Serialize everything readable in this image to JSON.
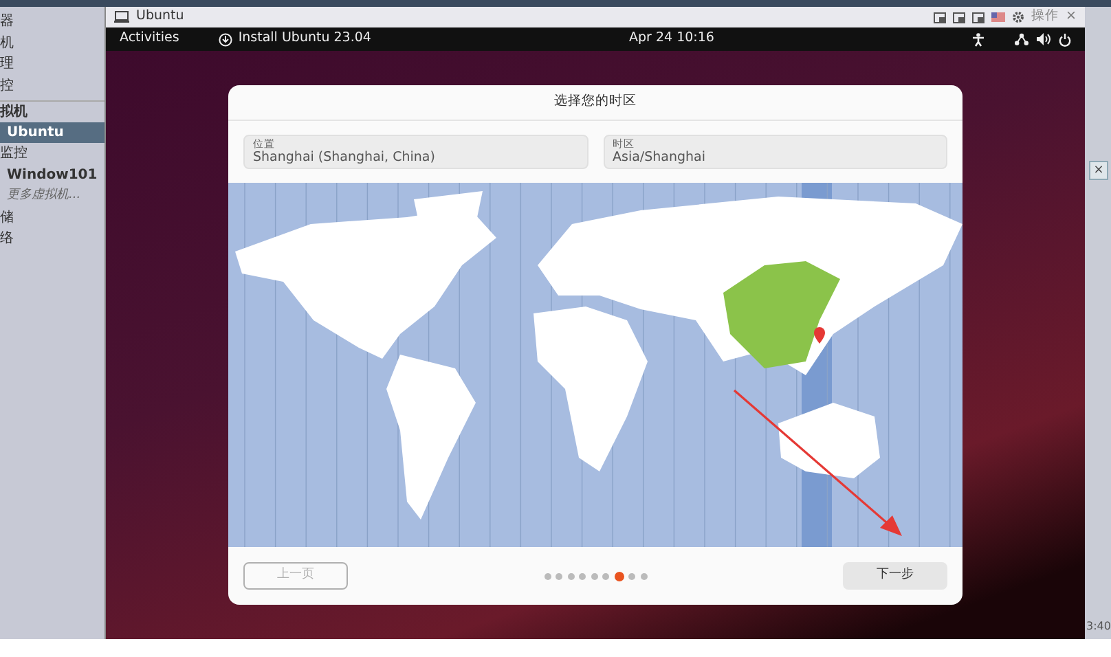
{
  "host_sidebar": {
    "items": [
      {
        "label": "器",
        "kind": "item",
        "selected": false
      },
      {
        "label": "机",
        "kind": "item",
        "selected": false
      },
      {
        "label": "理",
        "kind": "item",
        "selected": false
      },
      {
        "label": "控",
        "kind": "item",
        "selected": false
      },
      {
        "label": "拟机",
        "kind": "header",
        "selected": false
      },
      {
        "label": "Ubuntu",
        "kind": "vm",
        "selected": true
      },
      {
        "label": "监控",
        "kind": "item",
        "selected": false
      },
      {
        "label": "Window101",
        "kind": "vm",
        "selected": false
      },
      {
        "label": "更多虚拟机...",
        "kind": "more",
        "selected": false
      },
      {
        "label": "储",
        "kind": "item",
        "selected": false
      },
      {
        "label": "络",
        "kind": "item",
        "selected": false
      }
    ]
  },
  "vm_window": {
    "title": "Ubuntu",
    "actions_label": "操作",
    "close": "×"
  },
  "top_bar": {
    "activities": "Activities",
    "app": "Install Ubuntu 23.04",
    "clock": "Apr 24  10:16"
  },
  "dialog": {
    "title": "选择您的时区",
    "fields": [
      {
        "label": "位置",
        "value": "Shanghai (Shanghai, China)"
      },
      {
        "label": "时区",
        "value": "Asia/Shanghai"
      }
    ],
    "back_button": {
      "label": "上一页",
      "disabled": true
    },
    "next_button": {
      "label": "下一步",
      "disabled": false
    },
    "pager": [
      {
        "selected": false
      },
      {
        "selected": false
      },
      {
        "selected": false
      },
      {
        "selected": false
      },
      {
        "selected": false
      },
      {
        "selected": false
      },
      {
        "selected": true
      },
      {
        "selected": false
      },
      {
        "selected": false
      }
    ]
  },
  "right_panel": {
    "close": "×",
    "time": "3:40"
  }
}
